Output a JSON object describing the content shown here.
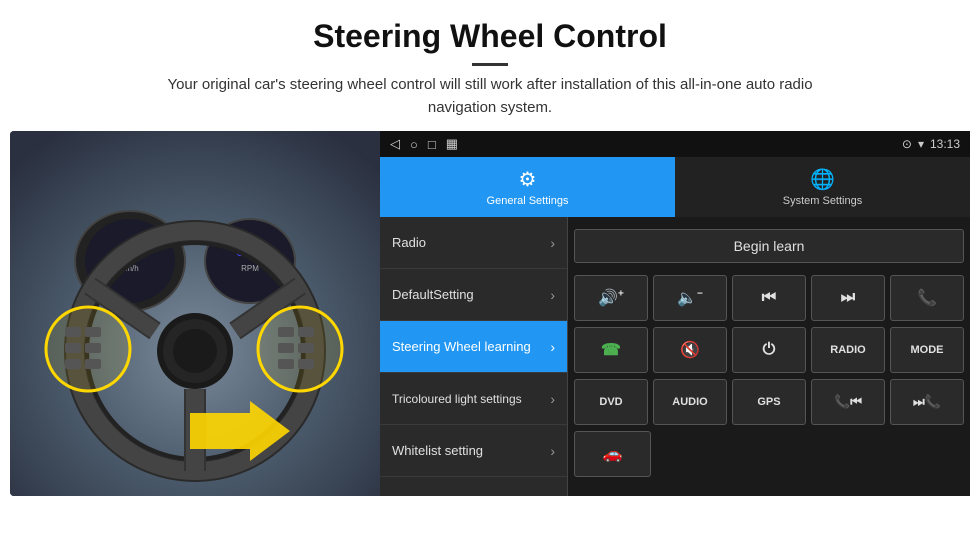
{
  "header": {
    "title": "Steering Wheel Control",
    "divider": true,
    "description": "Your original car's steering wheel control will still work after installation of this all-in-one auto radio navigation system."
  },
  "statusBar": {
    "icons": [
      "◁",
      "○",
      "□",
      "▦"
    ],
    "rightIcons": [
      "⊙",
      "▾",
      "13:13"
    ]
  },
  "tabs": [
    {
      "id": "general",
      "label": "General Settings",
      "icon": "⚙",
      "active": true
    },
    {
      "id": "system",
      "label": "System Settings",
      "icon": "🌐",
      "active": false
    }
  ],
  "menuItems": [
    {
      "id": "radio",
      "label": "Radio",
      "active": false
    },
    {
      "id": "default",
      "label": "DefaultSetting",
      "active": false
    },
    {
      "id": "steering",
      "label": "Steering Wheel learning",
      "active": true
    },
    {
      "id": "tricoloured",
      "label": "Tricoloured light settings",
      "active": false
    },
    {
      "id": "whitelist",
      "label": "Whitelist setting",
      "active": false
    }
  ],
  "controls": {
    "beginLearnLabel": "Begin learn",
    "row1": [
      {
        "id": "vol-up",
        "symbol": "🔊+",
        "label": "vol-up"
      },
      {
        "id": "vol-down",
        "symbol": "🔈-",
        "label": "vol-down"
      },
      {
        "id": "prev",
        "symbol": "⏮",
        "label": "prev"
      },
      {
        "id": "next",
        "symbol": "⏭",
        "label": "next"
      },
      {
        "id": "phone",
        "symbol": "📞",
        "label": "phone"
      }
    ],
    "row2": [
      {
        "id": "answer",
        "symbol": "📞",
        "label": "answer",
        "color": "green"
      },
      {
        "id": "mute",
        "symbol": "🔇",
        "label": "mute"
      },
      {
        "id": "power",
        "symbol": "⏻",
        "label": "power"
      },
      {
        "id": "radio-btn",
        "text": "RADIO",
        "label": "radio"
      },
      {
        "id": "mode-btn",
        "text": "MODE",
        "label": "mode"
      }
    ],
    "row3": [
      {
        "id": "dvd",
        "text": "DVD",
        "label": "dvd"
      },
      {
        "id": "audio",
        "text": "AUDIO",
        "label": "audio"
      },
      {
        "id": "gps",
        "text": "GPS",
        "label": "gps"
      },
      {
        "id": "phone2",
        "symbol": "📞⏮",
        "label": "phone-prev"
      },
      {
        "id": "skip2",
        "symbol": "⏭📞",
        "label": "skip-next"
      }
    ],
    "whitelist": {
      "icon": "🚗"
    }
  }
}
